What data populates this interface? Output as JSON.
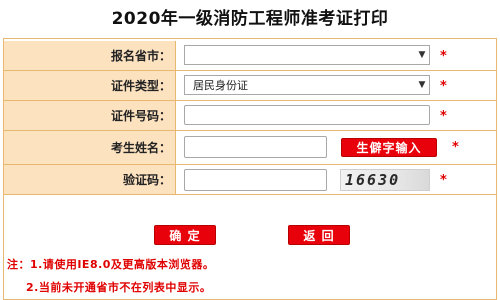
{
  "page": {
    "title": "2020年一级消防工程师准考证打印"
  },
  "form": {
    "province_label": "报名省市：",
    "province_value": "",
    "id_type_label": "证件类型：",
    "id_type_value": "居民身份证",
    "id_number_label": "证件号码：",
    "id_number_value": "",
    "name_label": "考生姓名：",
    "name_value": "",
    "rare_char_button": "生僻字输入",
    "captcha_label": "验证码：",
    "captcha_value": "",
    "captcha_text": "16630",
    "required_mark": "*"
  },
  "actions": {
    "confirm_label": "确 定",
    "back_label": "返 回"
  },
  "notes": {
    "line1": "注：1.请使用IE8.0及更高版本浏览器。",
    "line2": "2.当前未开通省市不在列表中显示。"
  },
  "colors": {
    "label_bg": "#fde2c0",
    "border": "#e8b870",
    "accent_red": "#e8000a"
  },
  "icons": {
    "dropdown": "chevron-down-icon"
  }
}
